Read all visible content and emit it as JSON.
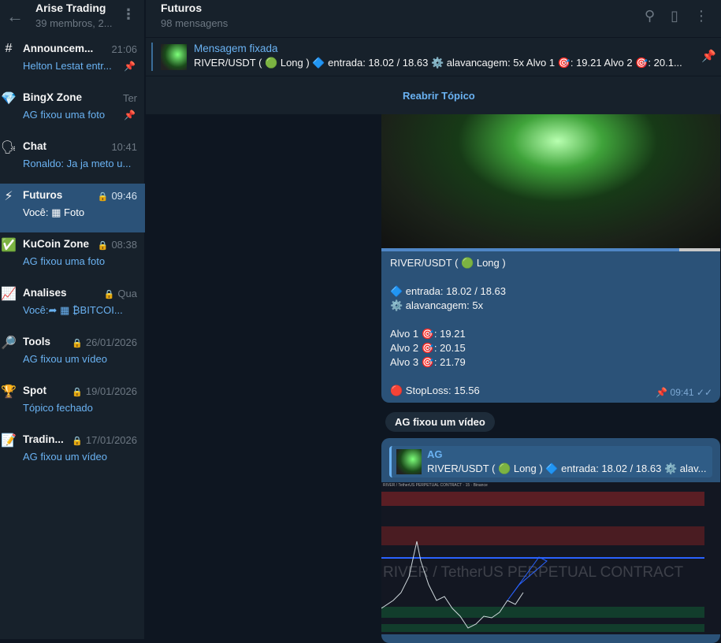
{
  "group": {
    "title": "Arise Trading",
    "subtitle": "39 membros, 2..."
  },
  "topics": [
    {
      "icon": "#",
      "name": "Announcem...",
      "time": "21:06",
      "preview": "Helton Lestat entr...",
      "pinned": true
    },
    {
      "icon": "💎",
      "name": "BingX Zone",
      "time": "Ter",
      "preview": "AG fixou uma foto",
      "pinned": true
    },
    {
      "icon": "🗣",
      "name": "Chat",
      "time": "10:41",
      "preview": "Ronaldo: Ja ja meto u..."
    },
    {
      "icon": "⚡",
      "name": "Futuros",
      "time": "09:46",
      "preview": "Você: ▦ Foto",
      "selected": true
    },
    {
      "icon": "✅",
      "name": "KuCoin Zone",
      "time": "08:38",
      "preview": "AG fixou uma foto"
    },
    {
      "icon": "📈",
      "name": "Analises",
      "time": "Qua",
      "preview": "Você:➦ ▦ ₿BITCOI..."
    },
    {
      "icon": "🔎",
      "name": "Tools",
      "time": "26/01/2026",
      "preview": "AG fixou um vídeo"
    },
    {
      "icon": "🏆",
      "name": "Spot",
      "time": "19/01/2026",
      "preview": "Tópico fechado"
    },
    {
      "icon": "📝",
      "name": "Tradin...",
      "time": "17/01/2026",
      "preview": "AG fixou um vídeo"
    }
  ],
  "chat": {
    "title": "Futuros",
    "subtitle": "98 mensagens"
  },
  "pinned": {
    "label": "Mensagem fixada",
    "text": "RIVER/USDT ( 🟢 Long )  🔷 entrada: 18.02 / 18.63 ⚙️ alavancagem: 5x  Alvo 1 🎯: 19.21 Alvo 2 🎯: 20.1..."
  },
  "reopen": "Reabrir Tópico",
  "message": {
    "lines": [
      "RIVER/USDT ( 🟢 Long )",
      "",
      "🔷 entrada: 18.02 / 18.63",
      "⚙️ alavancagem: 5x",
      "",
      "Alvo 1 🎯: 19.21",
      "Alvo 2 🎯: 20.15",
      "Alvo 3 🎯: 21.79",
      "",
      "🔴 StopLoss: 15.56"
    ],
    "time": "09:41"
  },
  "service": "AG fixou um vídeo",
  "reply": {
    "name": "AG",
    "text": "RIVER/USDT ( 🟢 Long )  🔷 entrada: 18.02 / 18.63 ⚙️ alav..."
  },
  "chart_image": {
    "header": "RIVER / TetherUS PERPETUAL CONTRACT · 15 · Binance",
    "watermark": "RIVER / TetherUS PERPETUAL CONTRACT"
  }
}
